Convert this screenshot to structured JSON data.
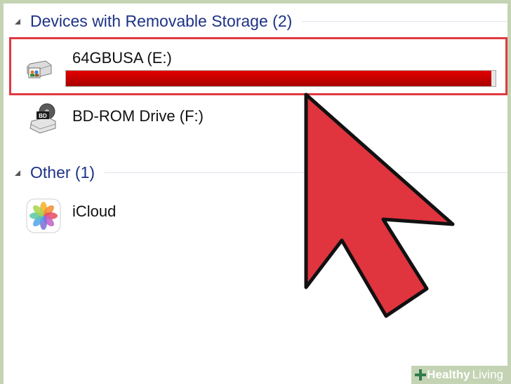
{
  "groups": {
    "removable": {
      "title": "Devices with Removable Storage (2)",
      "expanded": true
    },
    "other": {
      "title": "Other (1)",
      "expanded": true
    }
  },
  "devices": [
    {
      "label": "64GBUSA (E:)",
      "icon": "usb-drive-icon",
      "selected": true,
      "capacity_used_fraction": 0.99,
      "capacity_color": "#cc0000"
    },
    {
      "label": "BD-ROM Drive (F:)",
      "icon": "bd-rom-drive-icon",
      "icon_badge": "BD",
      "selected": false
    }
  ],
  "other_items": [
    {
      "label": "iCloud",
      "icon": "photos-icon"
    }
  ],
  "overlay": {
    "highlight_color": "#e0393f",
    "cursor_color": "#e0343e",
    "cursor_outline_color": "#111111"
  },
  "watermark": {
    "brand_bold": "Healthy",
    "brand_regular": "Living",
    "icon": "plus-leaf-icon"
  }
}
